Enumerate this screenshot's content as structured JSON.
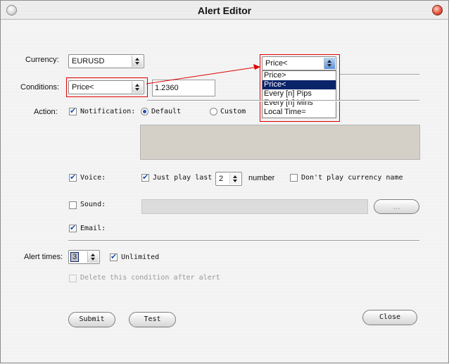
{
  "window": {
    "title": "Alert Editor"
  },
  "currency": {
    "label": "Currency:",
    "value": "EURUSD"
  },
  "conditions": {
    "label": "Conditions:",
    "value": "Price<",
    "threshold": "1.2360"
  },
  "dropdown": {
    "value": "Price<",
    "options": [
      "Price>",
      "Price<",
      "Every [n] Pips",
      "Every [n] Mins",
      "Local Time="
    ],
    "highlighted_index": 1
  },
  "action": {
    "label": "Action:",
    "notification_label": "Notification:",
    "notification_checked": true,
    "default_label": "Default",
    "custom_label": "Custom",
    "default_selected": true
  },
  "voice": {
    "label": "Voice:",
    "checked": true,
    "play_last_label": "Just play last",
    "play_last_checked": true,
    "count": "2",
    "number_label": "number",
    "dont_play_label": "Don't play currency name",
    "dont_play_checked": false
  },
  "sound": {
    "label": "Sound:",
    "checked": false,
    "browse_label": "..."
  },
  "email": {
    "label": "Email:",
    "checked": true
  },
  "alert_times": {
    "label": "Alert times:",
    "value": "3",
    "unlimited_label": "Unlimited",
    "unlimited_checked": true,
    "delete_label": "Delete this condition after alert",
    "delete_checked": false
  },
  "buttons": {
    "submit": "Submit",
    "test": "Test",
    "close": "Close"
  },
  "colors": {
    "highlight": "#0a246a",
    "annotation": "#e00000",
    "accent": "#1f4fae"
  }
}
